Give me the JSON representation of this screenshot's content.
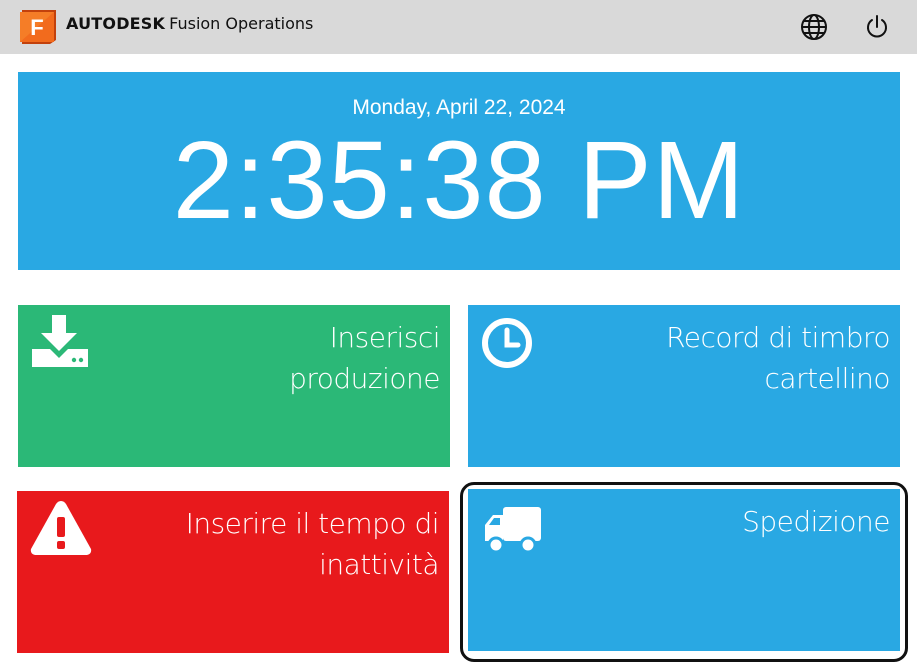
{
  "header": {
    "brand_bold": "AUTODESK",
    "brand_product": "Fusion Operations",
    "logo_letter": "F",
    "icons": {
      "language": "globe-icon",
      "power": "power-icon"
    }
  },
  "clock": {
    "date": "Monday, April 22, 2024",
    "time": "2:35:38 PM"
  },
  "tiles": [
    {
      "label_line1": "Inserisci",
      "label_line2": "produzione",
      "icon": "download-icon",
      "color": "#2bb877"
    },
    {
      "label_line1": "Record di timbro",
      "label_line2": "cartellino",
      "icon": "clock-icon",
      "color": "#29a8e3"
    },
    {
      "label_line1": "Inserire il tempo di",
      "label_line2": "inattività",
      "icon": "warning-icon",
      "color": "#e8191c"
    },
    {
      "label_line1": "Spedizione",
      "label_line2": "",
      "icon": "truck-icon",
      "color": "#29a8e3"
    }
  ],
  "colors": {
    "header_bg": "#d9d9d9",
    "blue": "#29a8e3",
    "green": "#2bb877",
    "red": "#e8191c",
    "logo_orange": "#f26b1d"
  }
}
